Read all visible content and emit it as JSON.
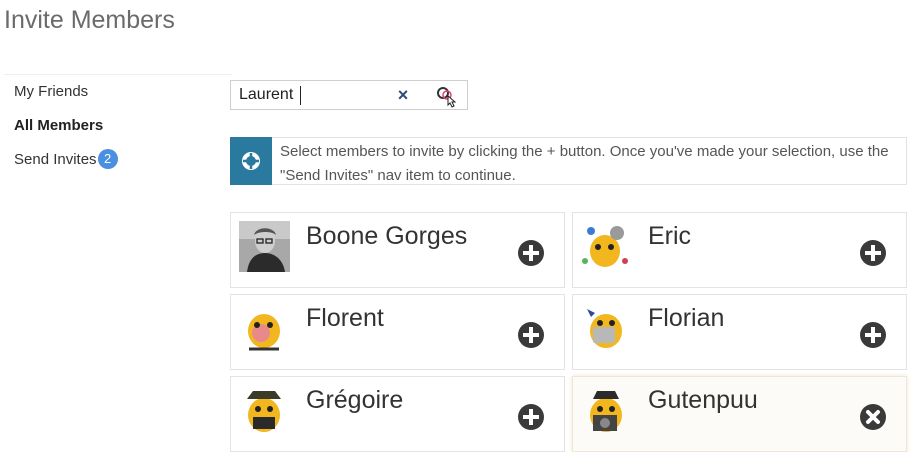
{
  "page": {
    "title": "Invite Members"
  },
  "sidebar": {
    "items": [
      {
        "label": "My Friends",
        "active": false
      },
      {
        "label": "All Members",
        "active": true
      },
      {
        "label": "Send Invites",
        "active": false,
        "badge": "2"
      }
    ]
  },
  "search": {
    "value": "Laurent",
    "clear_icon": "close-icon",
    "submit_icon": "search-icon"
  },
  "notice": {
    "icon": "lifebuoy-icon",
    "text": "Select members to invite by clicking the + button. Once you've made your selection, use the \"Send Invites\" nav item to continue."
  },
  "members": [
    {
      "name": "Boone Gorges",
      "avatar": "photo",
      "selected": false,
      "action_icon": "plus-circle-icon"
    },
    {
      "name": "Eric",
      "avatar": "wapuu",
      "selected": false,
      "action_icon": "plus-circle-icon"
    },
    {
      "name": "Florent",
      "avatar": "wapuu",
      "selected": false,
      "action_icon": "plus-circle-icon"
    },
    {
      "name": "Florian",
      "avatar": "wapuu",
      "selected": false,
      "action_icon": "plus-circle-icon"
    },
    {
      "name": "Grégoire",
      "avatar": "wapuu",
      "selected": false,
      "action_icon": "plus-circle-icon"
    },
    {
      "name": "Gutenpuu",
      "avatar": "wapuu",
      "selected": true,
      "action_icon": "remove-circle-icon"
    }
  ],
  "colors": {
    "accent": "#2a7aa0",
    "badge": "#4a8fe0",
    "button": "#3a3a3a",
    "wapuu": "#f2b61f"
  }
}
